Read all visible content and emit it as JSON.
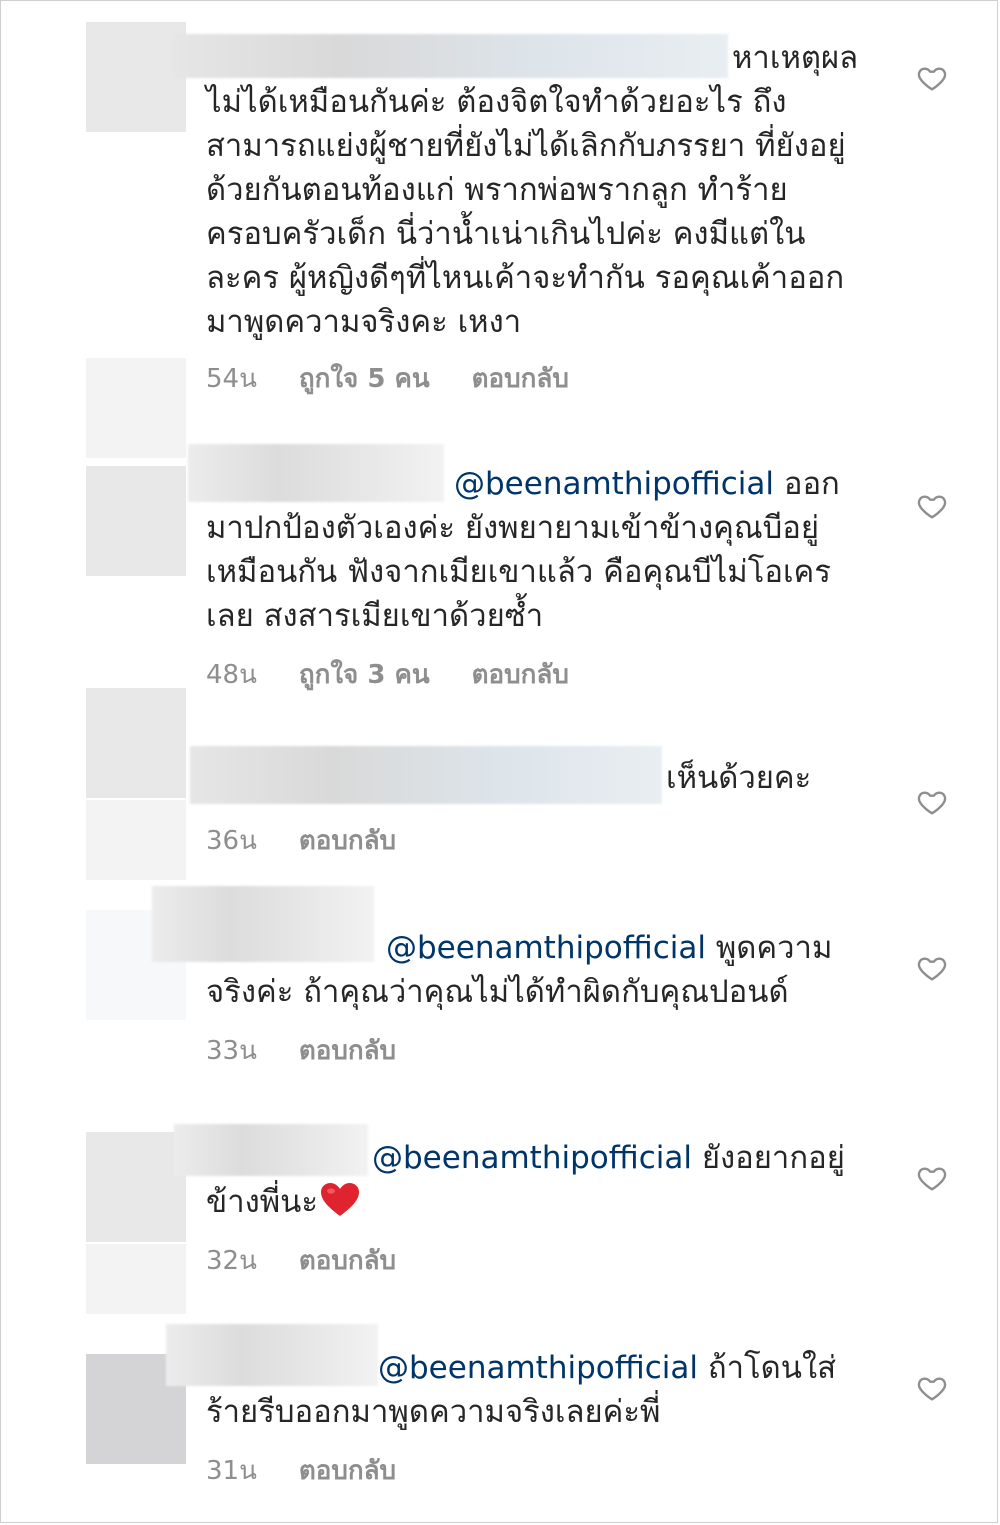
{
  "comments": [
    {
      "text_after_name": "หาเหตุผล",
      "text": "ไม่ได้เหมือนกันค่ะ ต้องจิตใจทำด้วยอะไร ถึงสามารถแย่งผู้ชายที่ยังไม่ได้เลิกกับภรรยา ที่ยังอยู่ด้วยกันตอนท้องแก่ พรากพ่อพรากลูก ทำร้ายครอบครัวเด็ก นี่ว่าน้ำเน่าเกินไปค่ะ คงมีแต่ในละคร ผู้หญิงดีๆที่ไหนเค้าจะทำกัน รอคุณเค้าออกมาพูดความจริงคะ เหงา",
      "time": "54น",
      "likes": "ถูกใจ 5 คน",
      "reply": "ตอบกลับ"
    },
    {
      "mention": "@beenamthipofficial",
      "text_after_mention": " ออก",
      "text": "มาปกป้องตัวเองค่ะ ยังพยายามเข้าข้างคุณบีอยู่เหมือนกัน ฟังจากเมียเขาแล้ว คือคุณบีไม่โอเครเลย สงสารเมียเขาด้วยซ้ำ",
      "time": "48น",
      "likes": "ถูกใจ 3 คน",
      "reply": "ตอบกลับ"
    },
    {
      "text_after_name": "เห็นด้วยคะ",
      "time": "36น",
      "reply": "ตอบกลับ"
    },
    {
      "mention": "@beenamthipofficial",
      "text_after_mention": " พูดความ",
      "text": "จริงค่ะ ถ้าคุณว่าคุณไม่ได้ทำผิดกับคุณปอนด์",
      "time": "33น",
      "reply": "ตอบกลับ"
    },
    {
      "mention": "@beenamthipofficial",
      "text_after_mention": " ยังอยากอยู่",
      "text": "ข้างพี่นะ",
      "time": "32น",
      "reply": "ตอบกลับ"
    },
    {
      "mention": "@beenamthipofficial",
      "text_after_mention": " ถ้าโดนใส่",
      "text": "ร้ายรีบออกมาพูดความจริงเลยค่ะพี่",
      "time": "31น",
      "reply": "ตอบกลับ"
    }
  ],
  "icons": {
    "like": "heart-outline-icon",
    "emoji": "red-heart-emoji"
  },
  "colors": {
    "mention": "#003569",
    "meta": "#8e8e8e",
    "heart_emoji": "#e0242f"
  }
}
